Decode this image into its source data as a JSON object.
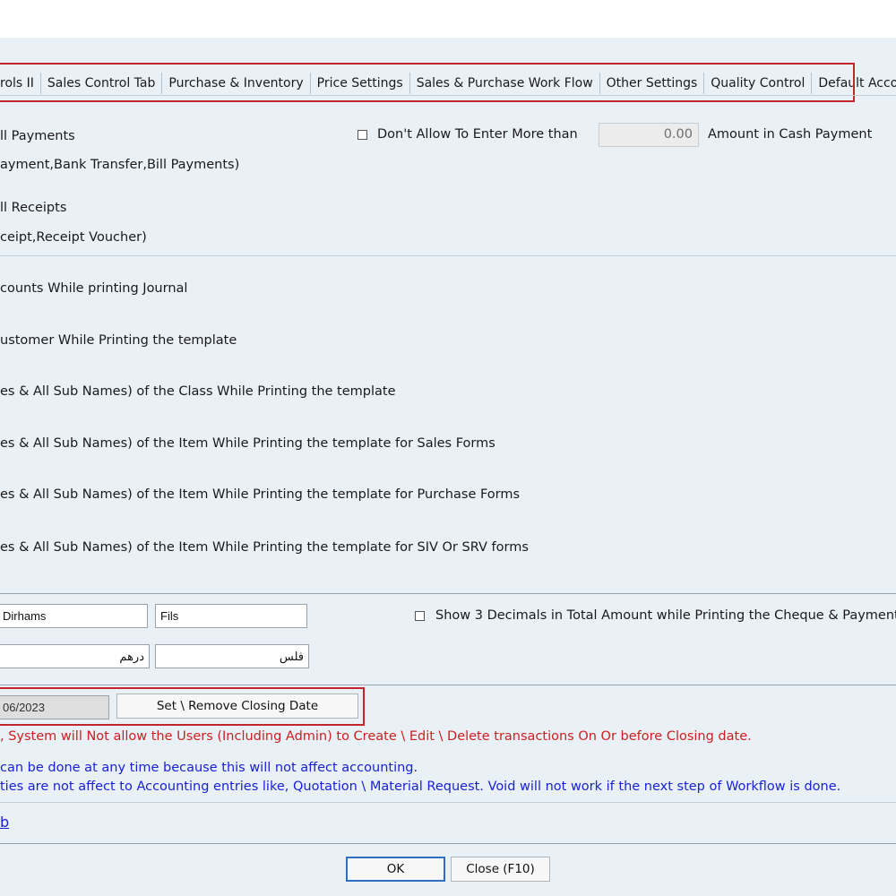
{
  "tabs": [
    "rols II",
    "Sales Control Tab",
    "Purchase & Inventory",
    "Price Settings",
    "Sales & Purchase Work Flow",
    "Other Settings",
    "Quality Control",
    "Default Accounts"
  ],
  "payments": {
    "line1": "ll Payments",
    "line2": "ayment,Bank Transfer,Bill Payments)",
    "dont_allow_label": "Don't Allow To Enter More than",
    "amount_value": "0.00",
    "amount_suffix": "Amount in Cash Payment"
  },
  "receipts": {
    "line1": "ll Receipts",
    "line2": "ceipt,Receipt Voucher)"
  },
  "printing_options": [
    "counts While printing Journal",
    "ustomer While Printing the template",
    "es & All Sub Names) of the Class While Printing the template",
    "es & All Sub Names) of the Item While Printing the template for Sales Forms",
    "es & All Sub Names) of the Item While Printing the template for Purchase Forms",
    "es & All Sub Names) of the Item While Printing the template for SIV Or SRV forms"
  ],
  "currency": {
    "main_en": "Dirhams",
    "sub_en": "Fils",
    "main_ar": "درهم",
    "sub_ar": "فلس",
    "show_3_decimals_label": "Show 3 Decimals in Total Amount while Printing the Cheque & Payment"
  },
  "closing": {
    "date": "06/2023",
    "set_button": "Set \\ Remove Closing Date",
    "warning": ", System will Not allow the Users (Including Admin)  to Create \\ Edit \\ Delete transactions On Or before Closing date.",
    "info1": " can be done at any time because this will not affect accounting.",
    "info2": "ties are not affect to Accounting entries like, Quotation \\ Material Request. Void will not work if the next step of Workflow is done."
  },
  "link_text": "b",
  "footer": {
    "ok": "OK",
    "close": "Close (F10)"
  },
  "colors": {
    "highlight": "#c0272d",
    "warning": "#cc1f1f",
    "info": "#1a22d6",
    "panel": "#e9f0f6"
  }
}
